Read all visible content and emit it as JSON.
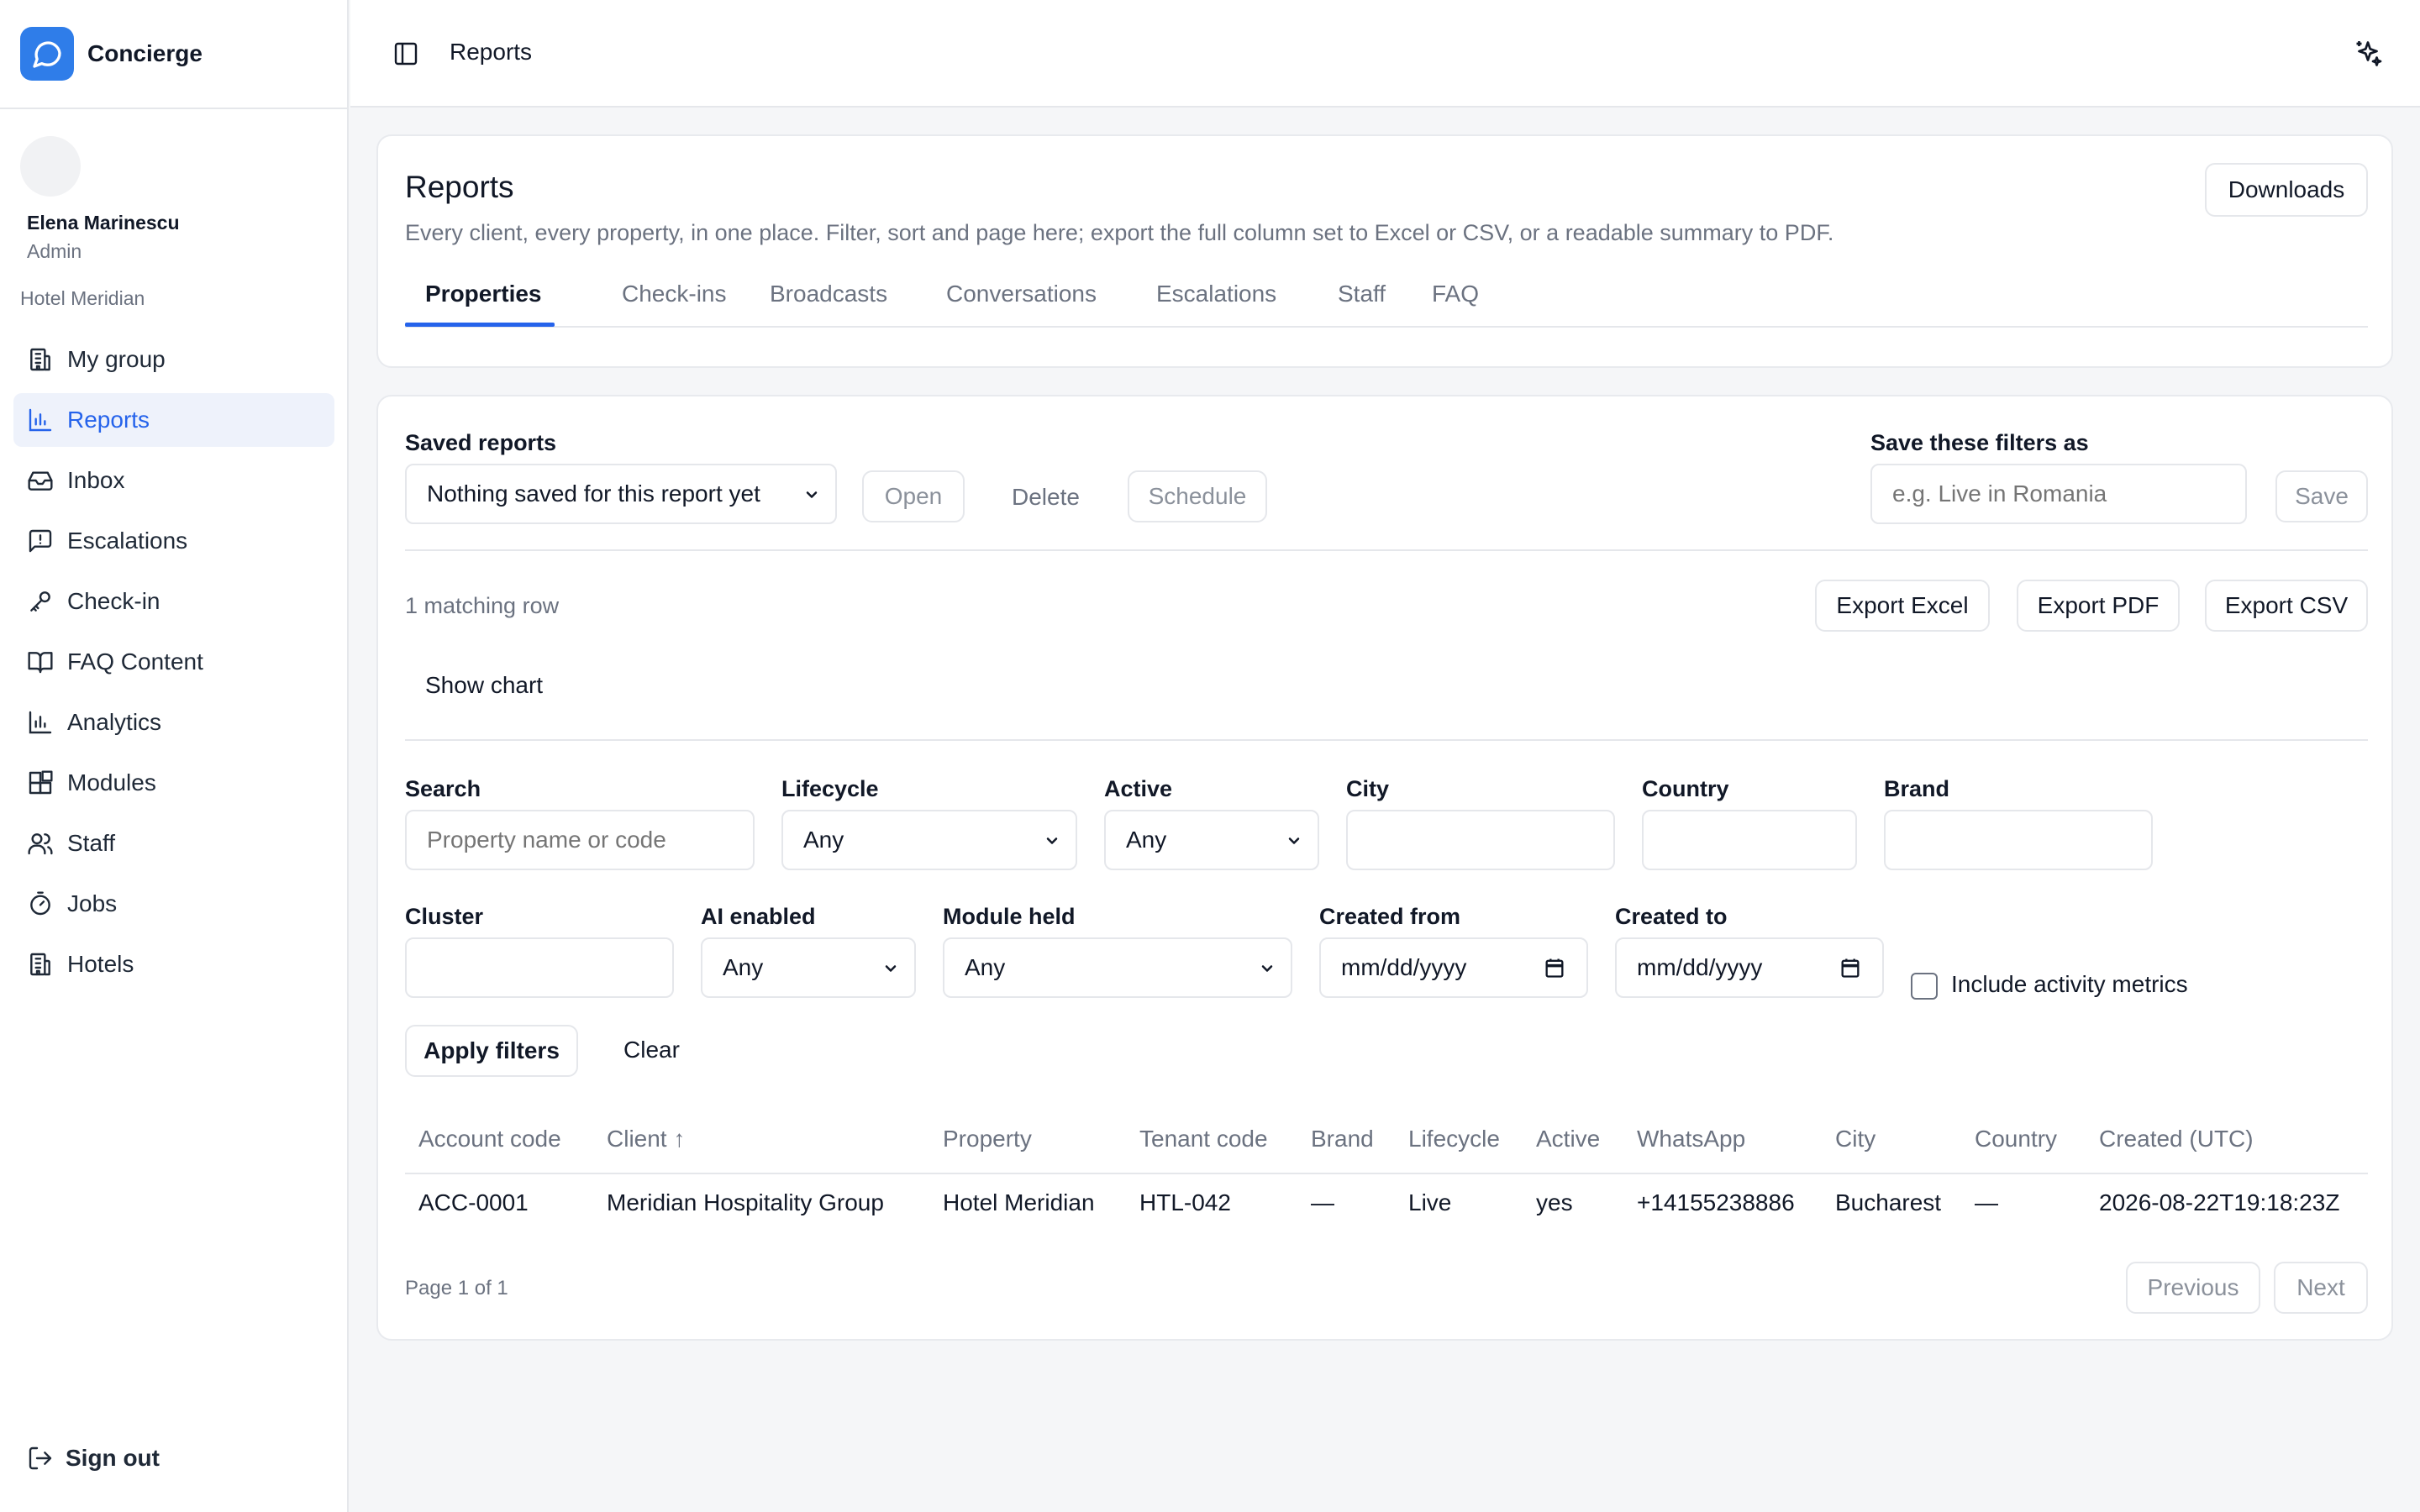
{
  "app": {
    "name": "Concierge"
  },
  "user": {
    "name": "Elena Marinescu",
    "role": "Admin",
    "hotel": "Hotel Meridian"
  },
  "nav": {
    "items": [
      {
        "label": "My group",
        "icon": "building-icon"
      },
      {
        "label": "Reports",
        "icon": "bar-chart-icon",
        "active": true
      },
      {
        "label": "Inbox",
        "icon": "inbox-icon"
      },
      {
        "label": "Escalations",
        "icon": "message-alert-icon"
      },
      {
        "label": "Check-in",
        "icon": "key-icon"
      },
      {
        "label": "FAQ Content",
        "icon": "book-icon"
      },
      {
        "label": "Analytics",
        "icon": "bar-chart-icon"
      },
      {
        "label": "Modules",
        "icon": "blocks-icon"
      },
      {
        "label": "Staff",
        "icon": "users-icon"
      },
      {
        "label": "Jobs",
        "icon": "timer-icon"
      },
      {
        "label": "Hotels",
        "icon": "building-icon"
      }
    ],
    "sign_out": "Sign out"
  },
  "topbar": {
    "title": "Reports"
  },
  "header": {
    "title": "Reports",
    "description": "Every client, every property, in one place. Filter, sort and page here; export the full column set to Excel or CSV, or a readable summary to PDF.",
    "downloads_label": "Downloads"
  },
  "tabs": [
    {
      "label": "Properties",
      "active": true
    },
    {
      "label": "Check-ins"
    },
    {
      "label": "Broadcasts"
    },
    {
      "label": "Conversations"
    },
    {
      "label": "Escalations"
    },
    {
      "label": "Staff"
    },
    {
      "label": "FAQ"
    }
  ],
  "saved_reports": {
    "label": "Saved reports",
    "selected": "Nothing saved for this report yet",
    "open_label": "Open",
    "delete_label": "Delete",
    "schedule_label": "Schedule",
    "save_as_label": "Save these filters as",
    "save_as_placeholder": "e.g. Live in Romania",
    "save_label": "Save"
  },
  "results": {
    "count_text": "1 matching row",
    "export_excel": "Export Excel",
    "export_pdf": "Export PDF",
    "export_csv": "Export CSV",
    "show_chart": "Show chart"
  },
  "filters": {
    "search": {
      "label": "Search",
      "placeholder": "Property name or code"
    },
    "lifecycle": {
      "label": "Lifecycle",
      "value": "Any"
    },
    "active": {
      "label": "Active",
      "value": "Any"
    },
    "city": {
      "label": "City",
      "value": ""
    },
    "country": {
      "label": "Country",
      "value": ""
    },
    "brand": {
      "label": "Brand",
      "value": ""
    },
    "cluster": {
      "label": "Cluster",
      "value": ""
    },
    "ai_enabled": {
      "label": "AI enabled",
      "value": "Any"
    },
    "module_held": {
      "label": "Module held",
      "value": "Any"
    },
    "created_from": {
      "label": "Created from",
      "placeholder": "mm/dd/yyyy"
    },
    "created_to": {
      "label": "Created to",
      "placeholder": "mm/dd/yyyy"
    },
    "include_activity": {
      "label": "Include activity metrics",
      "checked": false
    },
    "apply_label": "Apply filters",
    "clear_label": "Clear"
  },
  "table": {
    "columns": [
      "Account code",
      "Client ↑",
      "Property",
      "Tenant code",
      "Brand",
      "Lifecycle",
      "Active",
      "WhatsApp",
      "City",
      "Country",
      "Created (UTC)"
    ],
    "rows": [
      [
        "ACC-0001",
        "Meridian Hospitality Group",
        "Hotel Meridian",
        "HTL-042",
        "—",
        "Live",
        "yes",
        "+14155238886",
        "Bucharest",
        "—",
        "2026-08-22T19:18:23Z"
      ]
    ]
  },
  "pagination": {
    "info": "Page 1 of 1",
    "previous": "Previous",
    "next": "Next"
  },
  "colors": {
    "accent": "#2563eb",
    "logo": "#2f7de9",
    "active_nav_bg": "#eef2fb"
  }
}
